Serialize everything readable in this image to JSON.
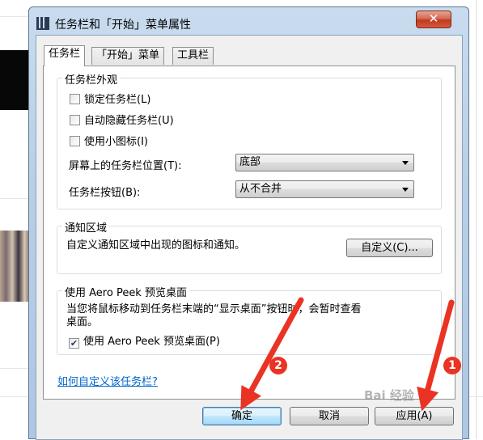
{
  "window": {
    "title": "任务栏和「开始」菜单属性",
    "close_glyph": "✕"
  },
  "tabs": [
    {
      "label": "任务栏",
      "active": true
    },
    {
      "label": "「开始」菜单",
      "active": false
    },
    {
      "label": "工具栏",
      "active": false
    }
  ],
  "appearance": {
    "title": "任务栏外观",
    "lock_taskbar": {
      "label": "锁定任务栏(L)",
      "checked": false
    },
    "auto_hide": {
      "label": "自动隐藏任务栏(U)",
      "checked": false
    },
    "small_icons": {
      "label": "使用小图标(I)",
      "checked": false
    },
    "location": {
      "label": "屏幕上的任务栏位置(T):",
      "value": "底部"
    },
    "buttons": {
      "label": "任务栏按钮(B):",
      "value": "从不合并"
    }
  },
  "notification": {
    "title": "通知区域",
    "description": "自定义通知区域中出现的图标和通知。",
    "customize_button": "自定义(C)..."
  },
  "aero_peek": {
    "title": "使用 Aero Peek 预览桌面",
    "description_line1": "当您将鼠标移动到任务栏末端的“显示桌面”按钮时，会暂时查看",
    "description_line2": "桌面。",
    "checkbox": {
      "label": "使用 Aero Peek 预览桌面(P)",
      "checked": true,
      "check_glyph": "✔"
    }
  },
  "help_link": "如何自定义该任务栏?",
  "footer": {
    "ok": "确定",
    "cancel": "取消",
    "apply": "应用(A)"
  },
  "annotations": {
    "badge1": "1",
    "badge2": "2",
    "color": "#ea3323"
  },
  "watermark": "Bai 经验"
}
